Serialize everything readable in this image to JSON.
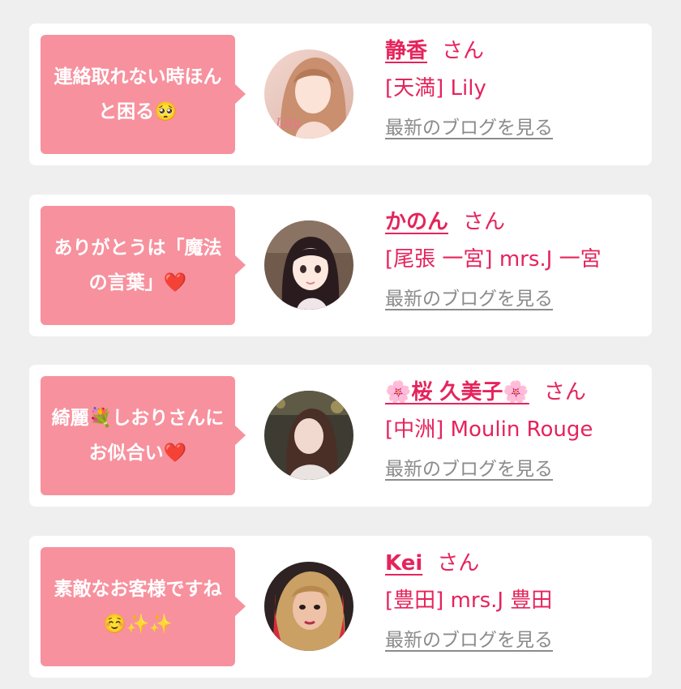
{
  "cards": [
    {
      "message": "連絡取れない時ほんと困る🥺",
      "name": "静香",
      "honorific": "さん",
      "shop": "[天満] Lily",
      "blog_link": "最新のブログを見る",
      "avatar_label": "Lily"
    },
    {
      "message": "ありがとうは「魔法の言葉」❤️",
      "name": "かのん",
      "honorific": "さん",
      "shop": "[尾張 一宮] mrs.J 一宮",
      "blog_link": "最新のブログを見る"
    },
    {
      "message": "綺麗💐しおりさんにお似合い❤️",
      "name": "🌸桜 久美子🌸",
      "honorific": "さん",
      "shop": "[中洲] Moulin Rouge",
      "blog_link": "最新のブログを見る"
    },
    {
      "message": "素敵なお客様ですね☺️✨✨",
      "name": "Kei",
      "honorific": "さん",
      "shop": "[豊田] mrs.J 豊田",
      "blog_link": "最新のブログを見る"
    }
  ],
  "colors": {
    "bubble": "#f7919e",
    "accent": "#e5245c",
    "link": "#8b8b8b",
    "background": "#efefef"
  }
}
